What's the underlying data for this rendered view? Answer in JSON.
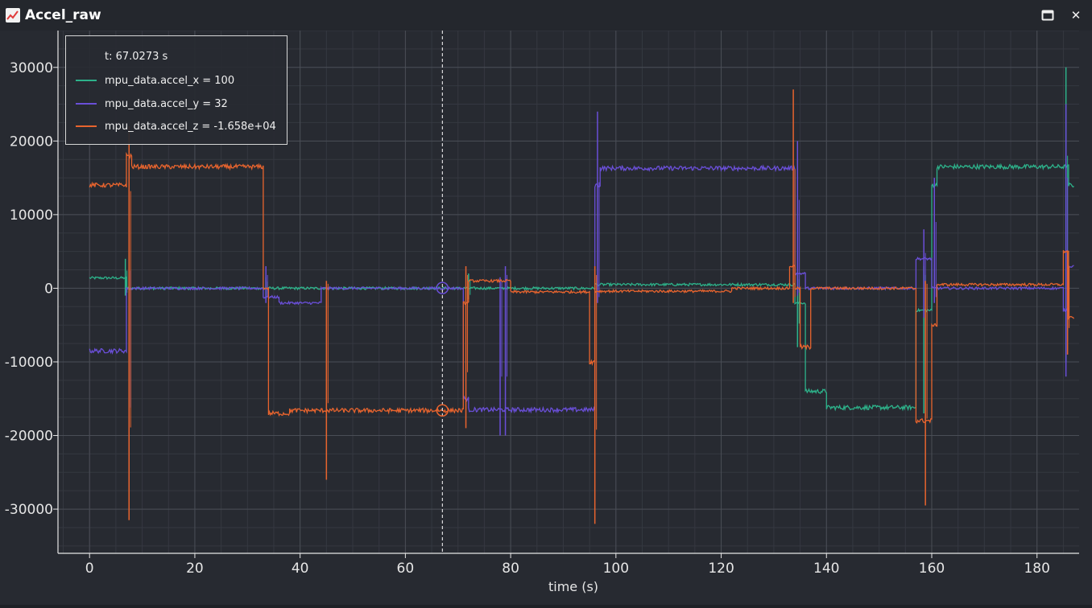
{
  "window": {
    "title": "Accel_raw",
    "app_icon": "line-chart-icon",
    "controls": [
      {
        "name": "maximize",
        "icon": "maximize-icon"
      },
      {
        "name": "close",
        "icon": "close-icon",
        "glyph": "✕"
      }
    ]
  },
  "legend": {
    "cursor_label": "t: 67.0273 s",
    "entries": [
      {
        "label": "mpu_data.accel_x = 100",
        "color": "#2db28a"
      },
      {
        "label": "mpu_data.accel_y = 32",
        "color": "#6a4fd8"
      },
      {
        "label": "mpu_data.accel_z = -1.658e+04",
        "color": "#e8642e"
      }
    ]
  },
  "colors": {
    "background": "#272a31",
    "grid_major": "#4a4e56",
    "grid_minor": "#353841",
    "axis": "#e6e6e6",
    "cursor": "#ffffff"
  },
  "chart_data": {
    "type": "line",
    "title": "",
    "xlabel": "time (s)",
    "ylabel": "",
    "xlim": [
      -6,
      188
    ],
    "ylim": [
      -36000,
      35000
    ],
    "x_ticks": [
      0,
      20,
      40,
      60,
      80,
      100,
      120,
      140,
      160,
      180
    ],
    "y_ticks": [
      -30000,
      -20000,
      -10000,
      0,
      10000,
      20000,
      30000
    ],
    "y_tick_labels": [
      "-30000",
      "-20000",
      "-10000",
      "0",
      "10000",
      "20000",
      "30000"
    ],
    "grid": true,
    "legend_position": "top-left",
    "cursor_time": 67.0273,
    "cursor_values": {
      "mpu_data.accel_x": 100,
      "mpu_data.accel_y": 32,
      "mpu_data.accel_z": -16580
    },
    "series": [
      {
        "name": "mpu_data.accel_x",
        "color": "#2db28a",
        "segments": [
          [
            0,
            7,
            1400
          ],
          [
            7,
            96,
            0
          ],
          [
            96,
            134,
            500
          ],
          [
            134,
            136,
            -2000
          ],
          [
            136,
            140,
            -14000
          ],
          [
            140,
            157,
            -16200
          ],
          [
            157,
            160,
            -3000
          ],
          [
            160,
            161,
            14000
          ],
          [
            161,
            186,
            16500
          ],
          [
            186,
            187,
            14000
          ]
        ],
        "spikes": [
          [
            6.8,
            4000,
            -1000
          ],
          [
            33.5,
            1500,
            -1500
          ],
          [
            72,
            2000,
            -1500
          ],
          [
            134.5,
            2000,
            -8000
          ],
          [
            185.5,
            30000,
            -10000
          ],
          [
            158.5,
            3000,
            -17000
          ]
        ]
      },
      {
        "name": "mpu_data.accel_y",
        "color": "#6a4fd8",
        "segments": [
          [
            0,
            7,
            -8500
          ],
          [
            7,
            33,
            0
          ],
          [
            33,
            36,
            -1200
          ],
          [
            36,
            44,
            -2000
          ],
          [
            44,
            71,
            0
          ],
          [
            71,
            72,
            -15000
          ],
          [
            72,
            96,
            -16500
          ],
          [
            96,
            97,
            14000
          ],
          [
            97,
            134,
            16300
          ],
          [
            134,
            136,
            2000
          ],
          [
            136,
            157,
            0
          ],
          [
            157,
            160,
            4000
          ],
          [
            160,
            185,
            0
          ],
          [
            185,
            186,
            -3000
          ],
          [
            186,
            187,
            3000
          ]
        ],
        "spikes": [
          [
            7.5,
            4000,
            -27000
          ],
          [
            33.5,
            3000,
            -2000
          ],
          [
            79,
            3000,
            -20000
          ],
          [
            96.5,
            24000,
            -2000
          ],
          [
            134.5,
            20000,
            -1000
          ],
          [
            158.5,
            8000,
            -4000
          ],
          [
            160.5,
            15000,
            -2000
          ],
          [
            185.5,
            25000,
            -12000
          ],
          [
            78,
            1500,
            -20000
          ]
        ]
      },
      {
        "name": "mpu_data.accel_z",
        "color": "#e8642e",
        "segments": [
          [
            0,
            7,
            14000
          ],
          [
            7,
            8,
            18000
          ],
          [
            8,
            33,
            16500
          ],
          [
            33,
            34,
            0
          ],
          [
            34,
            38,
            -17000
          ],
          [
            38,
            71,
            -16600
          ],
          [
            71,
            72,
            -2000
          ],
          [
            72,
            80,
            1000
          ],
          [
            80,
            95,
            -500
          ],
          [
            95,
            96,
            -10000
          ],
          [
            96,
            122,
            -400
          ],
          [
            122,
            133,
            0
          ],
          [
            133,
            134,
            3000
          ],
          [
            134,
            135,
            0
          ],
          [
            135,
            137,
            -8000
          ],
          [
            137,
            157,
            0
          ],
          [
            157,
            160,
            -18000
          ],
          [
            160,
            161,
            -5000
          ],
          [
            161,
            185,
            500
          ],
          [
            185,
            186,
            5000
          ],
          [
            186,
            187,
            -4000
          ]
        ],
        "spikes": [
          [
            7.5,
            22000,
            -31500
          ],
          [
            45,
            1000,
            -26000
          ],
          [
            96,
            3000,
            -32000
          ],
          [
            133.7,
            27000,
            -2000
          ],
          [
            158.8,
            1000,
            -29500
          ],
          [
            71.5,
            3000,
            -19000
          ],
          [
            185.8,
            5000,
            -9000
          ]
        ]
      }
    ]
  }
}
